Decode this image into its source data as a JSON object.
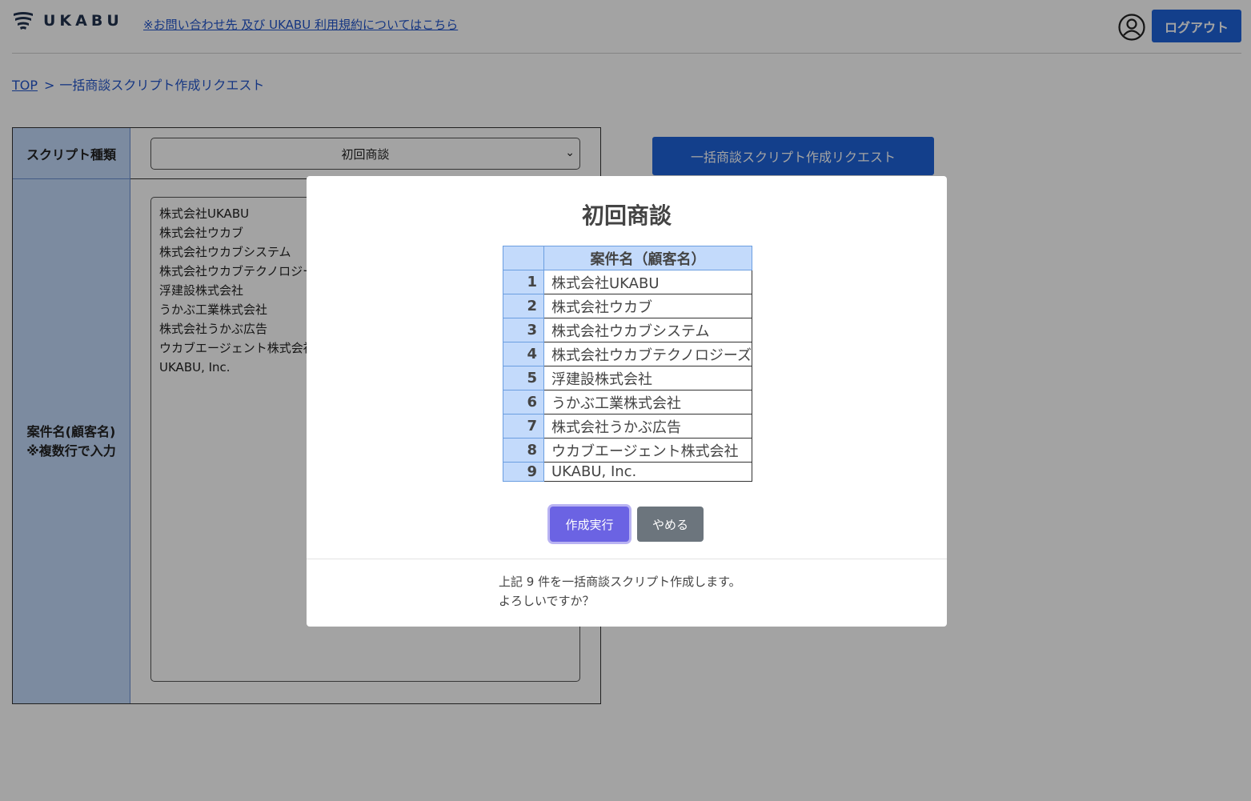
{
  "header": {
    "logo_text": "UKABU",
    "contact_link": "※お問い合わせ先 及び UKABU 利用規約についてはこちら",
    "logout_label": "ログアウト"
  },
  "breadcrumb": {
    "top": "TOP",
    "separator": ">",
    "current": "一括商談スクリプト作成リクエスト"
  },
  "form": {
    "script_type_label": "スクリプト種類",
    "script_type_value": "初回商談",
    "names_label_line1": "案件名(顧客名)",
    "names_label_line2": "※複数行で入力",
    "names_lines": [
      "株式会社UKABU",
      "株式会社ウカブ",
      "株式会社ウカブシステム",
      "株式会社ウカブテクノロジーズ",
      "浮建設株式会社",
      "うかぶ工業株式会社",
      "株式会社うかぶ広告",
      "ウカブエージェント株式会社",
      "UKABU, Inc."
    ],
    "submit_label": "一括商談スクリプト作成リクエスト"
  },
  "modal": {
    "title": "初回商談",
    "table_header": "案件名（顧客名）",
    "rows": [
      {
        "num": "1",
        "name": "株式会社UKABU"
      },
      {
        "num": "2",
        "name": "株式会社ウカブ"
      },
      {
        "num": "3",
        "name": "株式会社ウカブシステム"
      },
      {
        "num": "4",
        "name": "株式会社ウカブテクノロジーズ"
      },
      {
        "num": "5",
        "name": "浮建設株式会社"
      },
      {
        "num": "6",
        "name": "うかぶ工業株式会社"
      },
      {
        "num": "7",
        "name": "株式会社うかぶ広告"
      },
      {
        "num": "8",
        "name": "ウカブエージェント株式会社"
      },
      {
        "num": "9",
        "name": "UKABU, Inc."
      }
    ],
    "exec_label": "作成実行",
    "cancel_label": "やめる",
    "message_line1": "上記 9 件を一括商談スクリプト作成します。",
    "message_line2": "よろしいですか？"
  },
  "colors": {
    "primary": "#1f63d9",
    "header_cell": "#c3dafb",
    "exec_button": "#6b63e3",
    "cancel_button": "#6c757d"
  },
  "icons": [
    "logo-wave-icon",
    "user-circle-icon",
    "chevron-down-icon"
  ]
}
